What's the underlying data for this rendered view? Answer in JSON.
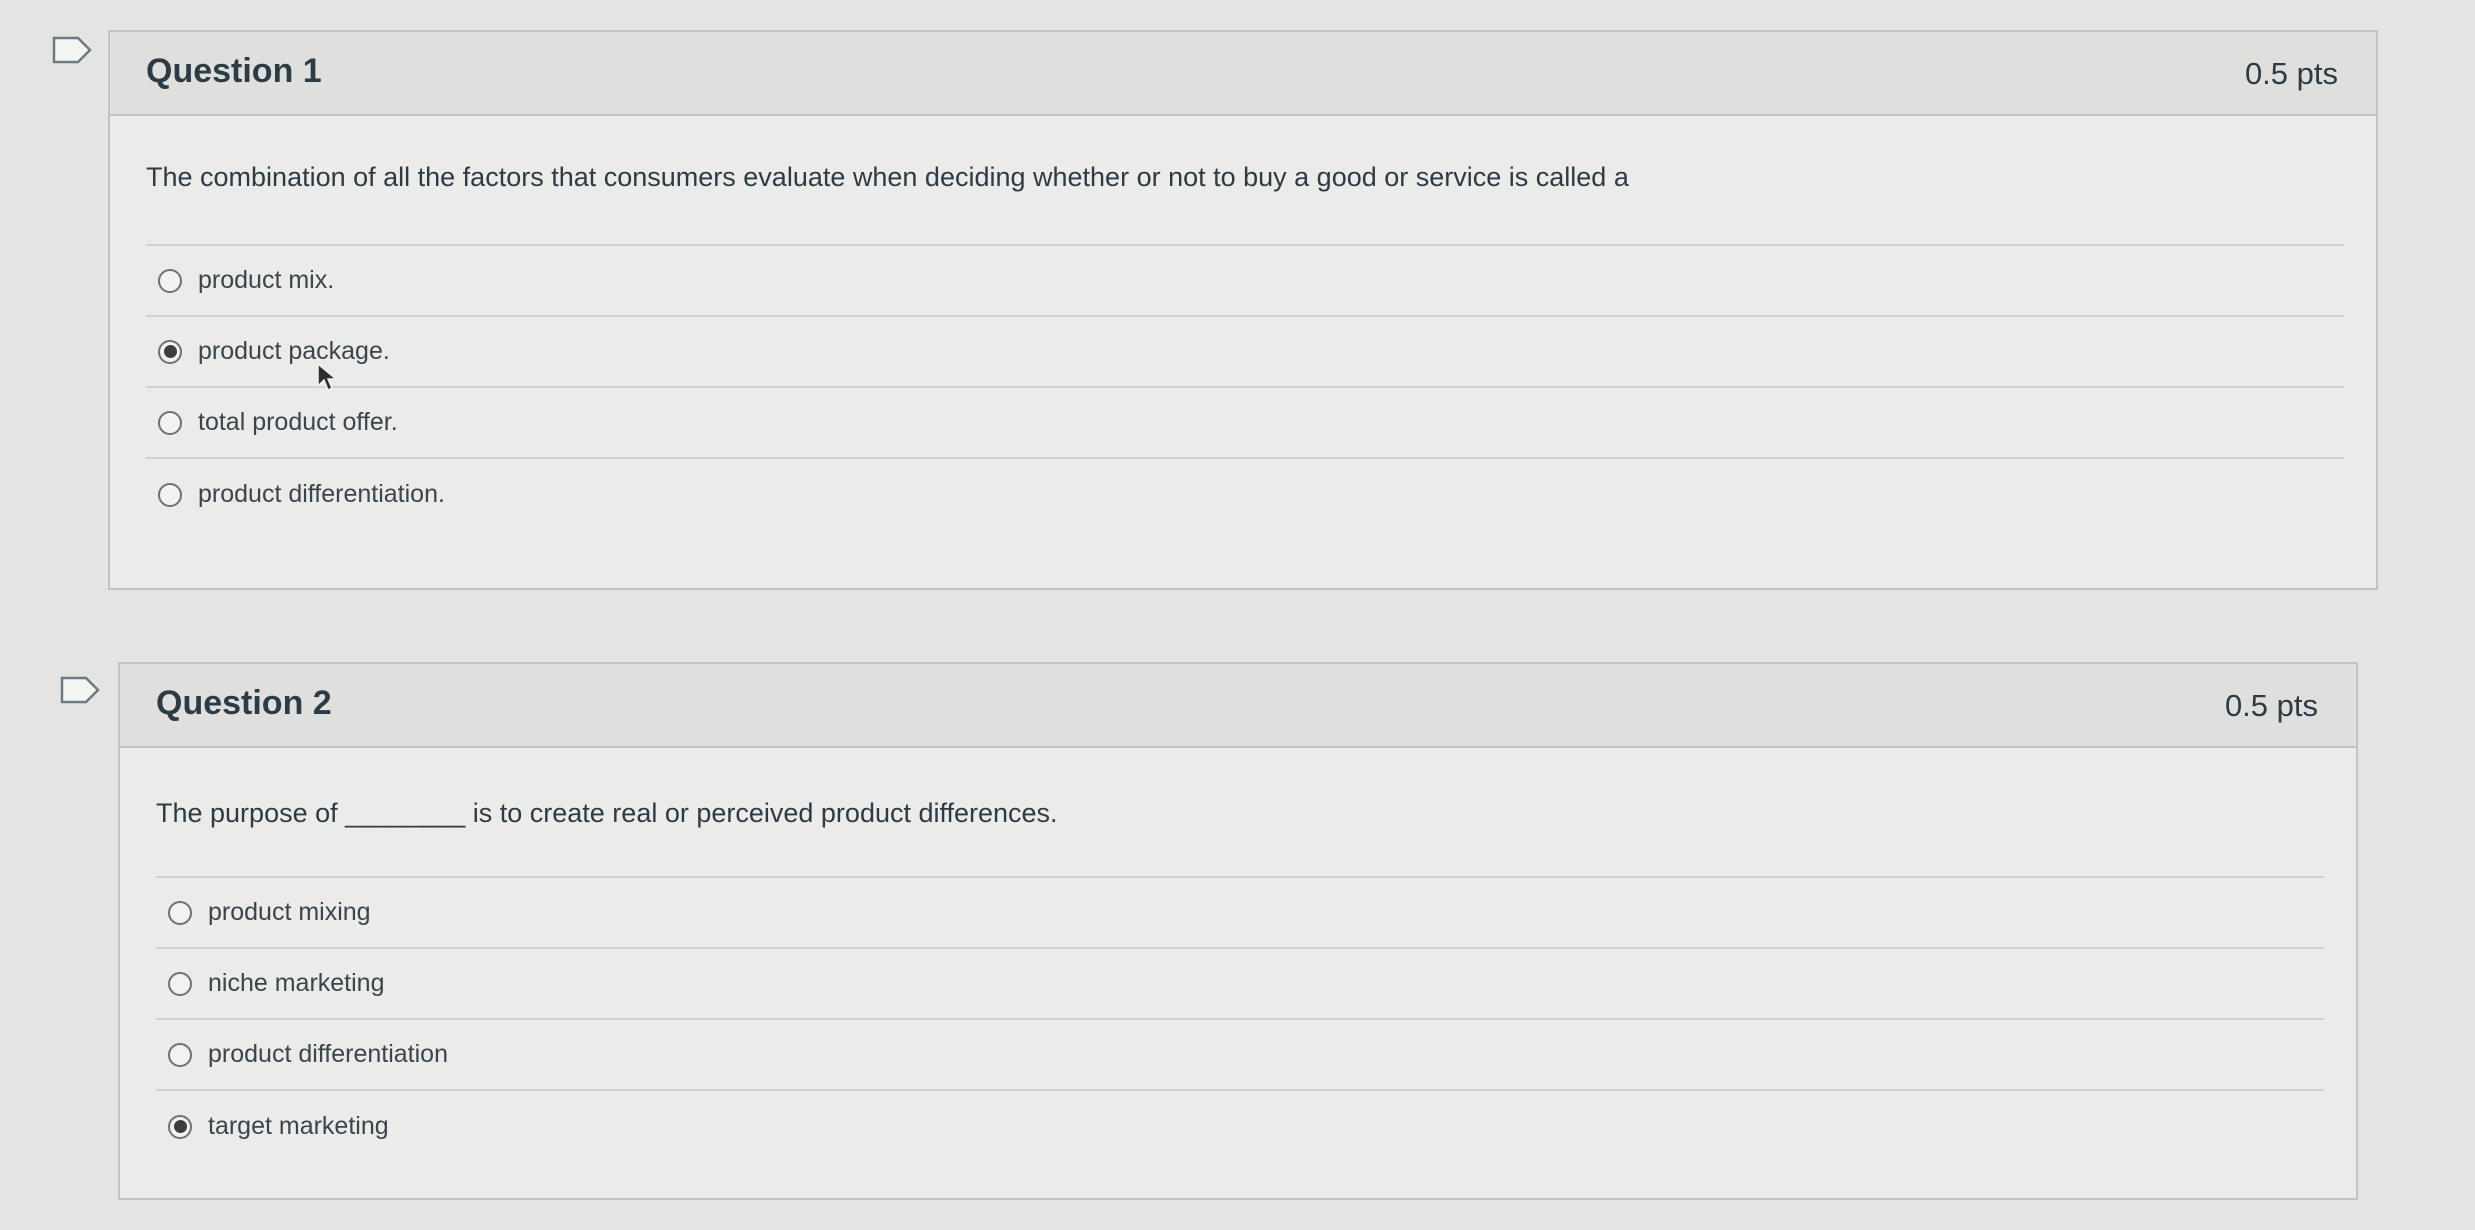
{
  "questions": [
    {
      "title": "Question 1",
      "points": "0.5 pts",
      "text": "The combination of all the factors that consumers evaluate when deciding whether or not to buy a good or service is called a",
      "answers": [
        {
          "label": "product mix.",
          "selected": false
        },
        {
          "label": "product package.",
          "selected": true
        },
        {
          "label": "total product offer.",
          "selected": false
        },
        {
          "label": "product differentiation.",
          "selected": false
        }
      ]
    },
    {
      "title": "Question 2",
      "points": "0.5 pts",
      "text": "The purpose of ________ is to create real or perceived product differences.",
      "answers": [
        {
          "label": "product mixing",
          "selected": false
        },
        {
          "label": "niche marketing",
          "selected": false
        },
        {
          "label": "product differentiation",
          "selected": false
        },
        {
          "label": "target marketing",
          "selected": true
        }
      ]
    }
  ],
  "icons": {
    "flag": "flag-question-icon",
    "cursor": "mouse-pointer-icon"
  },
  "colors": {
    "background": "#e4e4e2",
    "header": "#dfe0de",
    "border": "#c3c4c2",
    "text": "#2d3b45"
  }
}
